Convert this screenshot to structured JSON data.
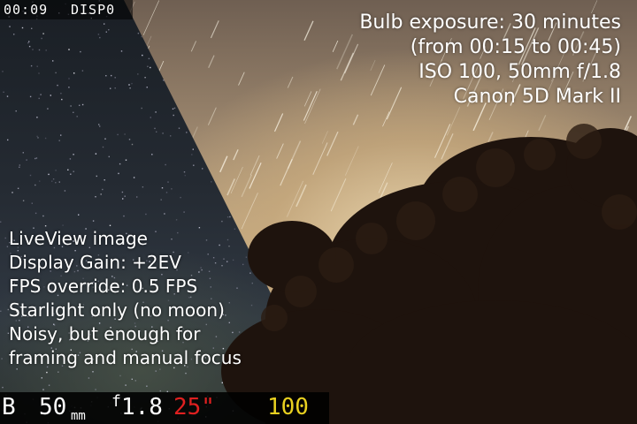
{
  "top_hud": {
    "time": "00:09",
    "display": "DISP0"
  },
  "exposure_info": [
    "Bulb exposure: 30 minutes",
    "(from 00:15 to 00:45)",
    "ISO 100, 50mm f/1.8",
    "Canon 5D Mark II"
  ],
  "liveview_notes": [
    "LiveView image",
    "Display Gain: +2EV",
    "FPS override: 0.5 FPS",
    "Starlight only (no moon)",
    "Noisy, but enough for",
    "framing and manual focus"
  ],
  "bottom_bar": {
    "mode": "B",
    "focal_length": "50",
    "focal_unit": "mm",
    "f_symbol": "f",
    "aperture": "1.8",
    "shutter": "25\"",
    "iso": "100"
  },
  "colors": {
    "shutter": "#e02020",
    "iso": "#e8d020",
    "text": "#ffffff"
  }
}
